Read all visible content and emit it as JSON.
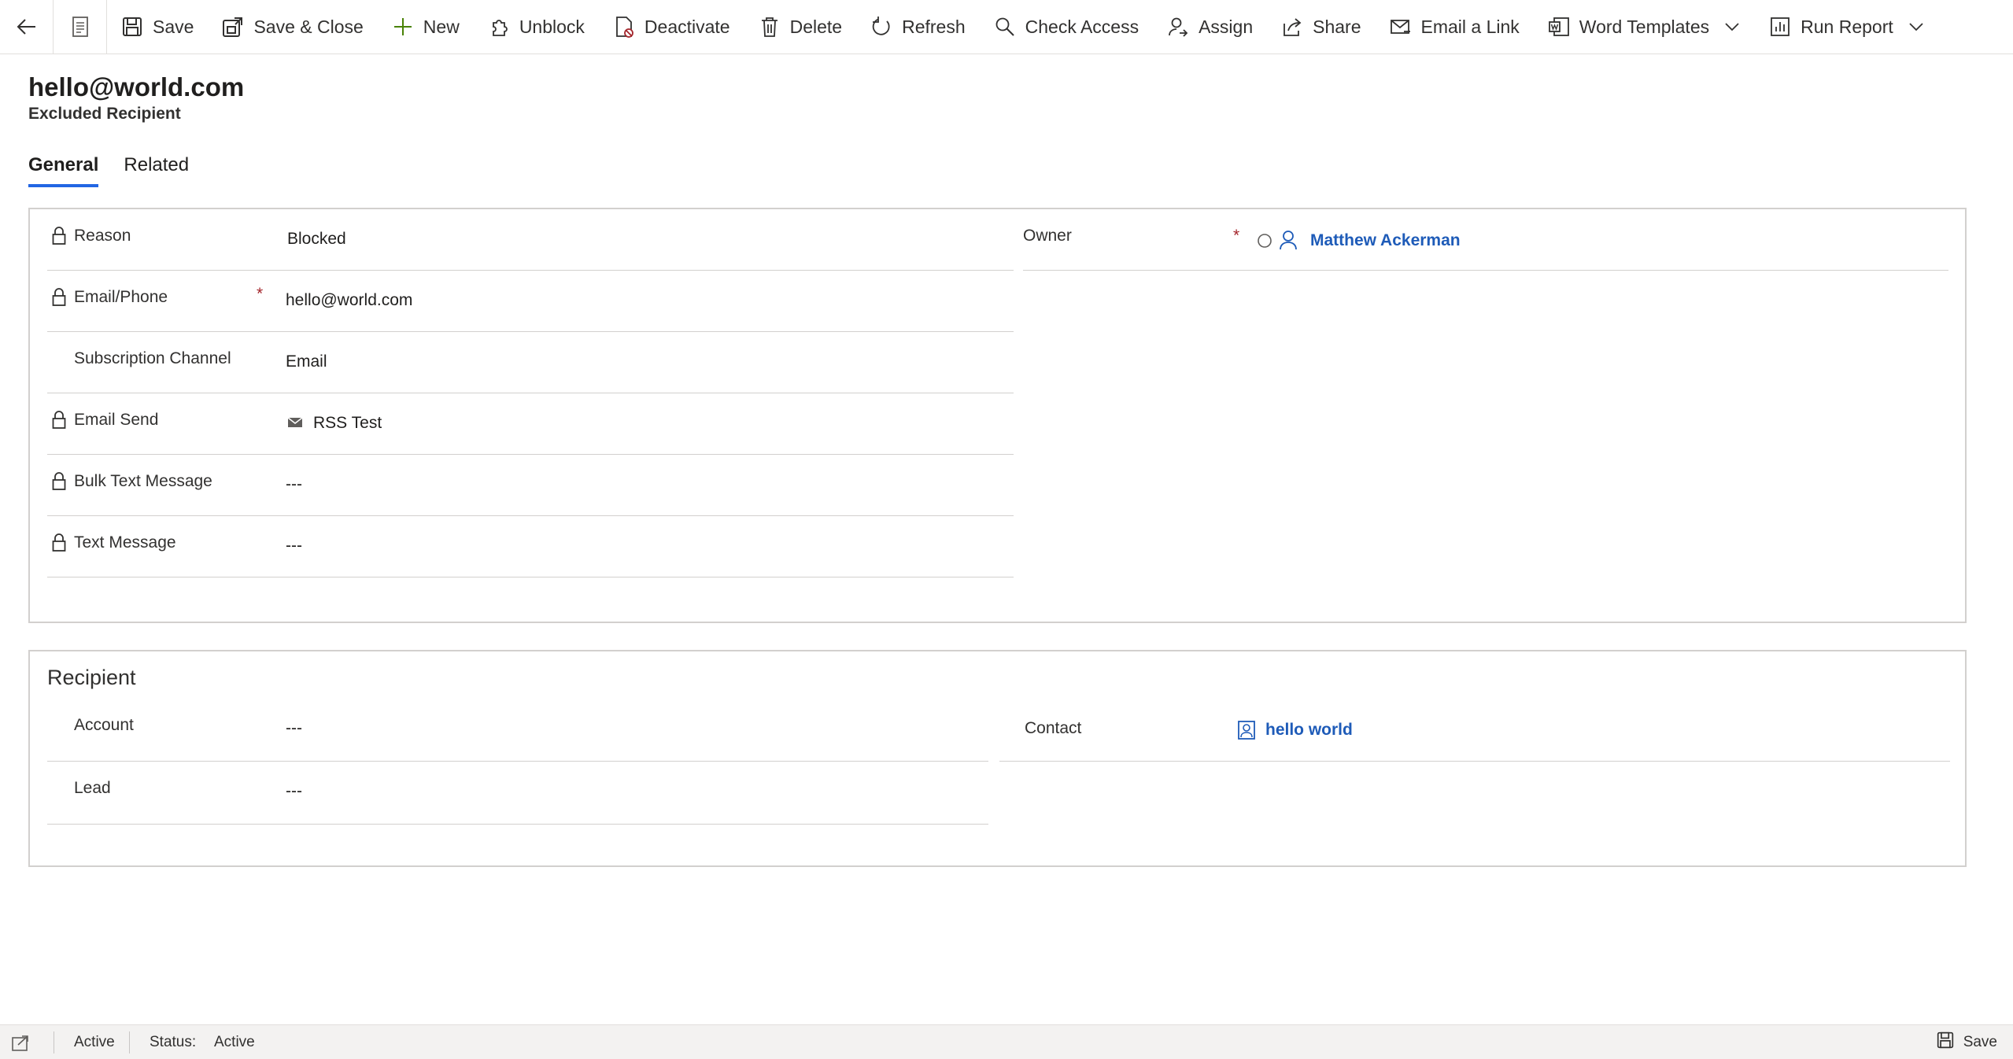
{
  "toolbar": {
    "save": "Save",
    "save_close": "Save & Close",
    "new": "New",
    "unblock": "Unblock",
    "deactivate": "Deactivate",
    "delete": "Delete",
    "refresh": "Refresh",
    "check_access": "Check Access",
    "assign": "Assign",
    "share": "Share",
    "email_link": "Email a Link",
    "word_templates": "Word Templates",
    "run_report": "Run Report"
  },
  "record": {
    "title": "hello@world.com",
    "entity": "Excluded Recipient"
  },
  "tabs": [
    "General",
    "Related"
  ],
  "general": {
    "reason": {
      "label": "Reason",
      "value": "Blocked"
    },
    "email_phone": {
      "label": "Email/Phone",
      "value": "hello@world.com"
    },
    "subscription_channel": {
      "label": "Subscription Channel",
      "value": "Email"
    },
    "email_send": {
      "label": "Email Send",
      "value": "RSS Test"
    },
    "bulk_text_message": {
      "label": "Bulk Text Message",
      "value": "---"
    },
    "text_message": {
      "label": "Text Message",
      "value": "---"
    },
    "owner": {
      "label": "Owner",
      "value": "Matthew Ackerman"
    }
  },
  "recipient": {
    "title": "Recipient",
    "account": {
      "label": "Account",
      "value": "---"
    },
    "lead": {
      "label": "Lead",
      "value": "---"
    },
    "contact": {
      "label": "Contact",
      "value": "hello world"
    }
  },
  "required_mark": "*",
  "status_bar": {
    "state": "Active",
    "status_label": "Status:",
    "status_value": "Active",
    "save": "Save"
  },
  "colors": {
    "link": "#1e5bb8",
    "tab_underline": "#2266e3",
    "required": "#a4262c"
  }
}
